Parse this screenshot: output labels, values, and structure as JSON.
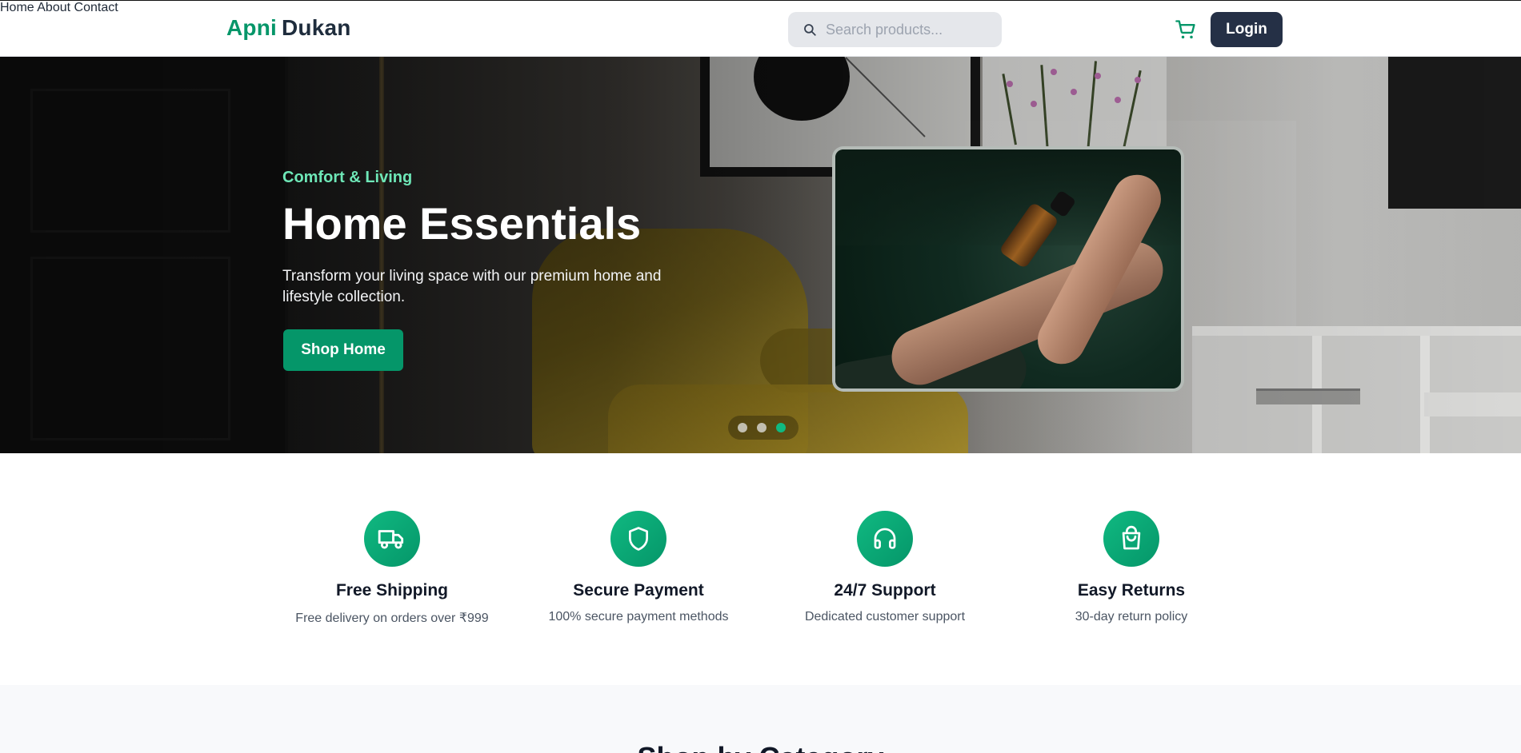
{
  "header": {
    "logo_part1": "Apni",
    "logo_part2": "Dukan",
    "nav": [
      {
        "label": "Home"
      },
      {
        "label": "About"
      },
      {
        "label": "Contact"
      }
    ],
    "search_placeholder": "Search products...",
    "cart_icon": "cart-icon",
    "login_label": "Login"
  },
  "hero": {
    "kicker": "Comfort & Living",
    "title": "Home Essentials",
    "description": "Transform your living space with our premium home and lifestyle collection.",
    "button_label": "Shop Home",
    "slides_count": 3,
    "active_slide": 3
  },
  "features": [
    {
      "icon": "truck-icon",
      "title": "Free Shipping",
      "description": "Free delivery on orders over ₹999"
    },
    {
      "icon": "shield-icon",
      "title": "Secure Payment",
      "description": "100% secure payment methods"
    },
    {
      "icon": "headphones-icon",
      "title": "24/7 Support",
      "description": "Dedicated customer support"
    },
    {
      "icon": "shopping-bag-icon",
      "title": "Easy Returns",
      "description": "30-day return policy"
    }
  ],
  "categories": {
    "title": "Shop by Category"
  },
  "colors": {
    "brand_green": "#059669",
    "brand_dark": "#1f2d3d",
    "accent_light_green": "#6ee7b7",
    "login_bg": "#253046"
  }
}
